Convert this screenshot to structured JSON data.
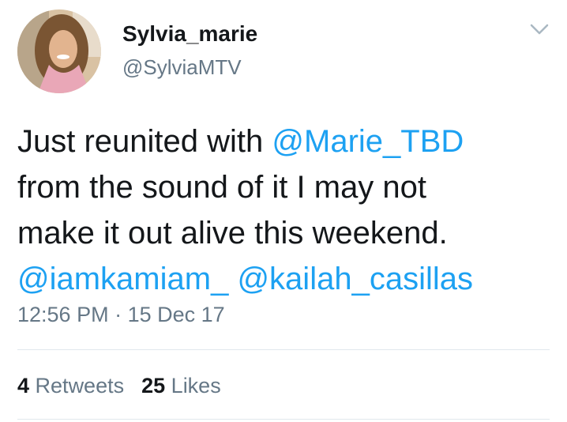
{
  "user": {
    "display_name": "Sylvia_marie",
    "handle": "@SylviaMTV"
  },
  "tweet": {
    "line1_text": "Just reunited with ",
    "line1_mention": "@Marie_TBD",
    "line2_text": "from the sound of it I may not",
    "line3_text": "make it out alive this weekend.",
    "line4_mention1": "@iamkamiam_",
    "line4_mention2": "@kailah_casillas"
  },
  "meta": {
    "time": "12:56 PM",
    "separator": " · ",
    "date": "15 Dec 17"
  },
  "stats": {
    "retweets_count": "4",
    "retweets_label": "Retweets",
    "likes_count": "25",
    "likes_label": "Likes"
  },
  "icons": {
    "menu": "chevron-down-icon"
  },
  "colors": {
    "mention": "#1da1f2",
    "secondary_text": "#657786",
    "primary_text": "#14171a",
    "divider": "#e1e8ed"
  }
}
